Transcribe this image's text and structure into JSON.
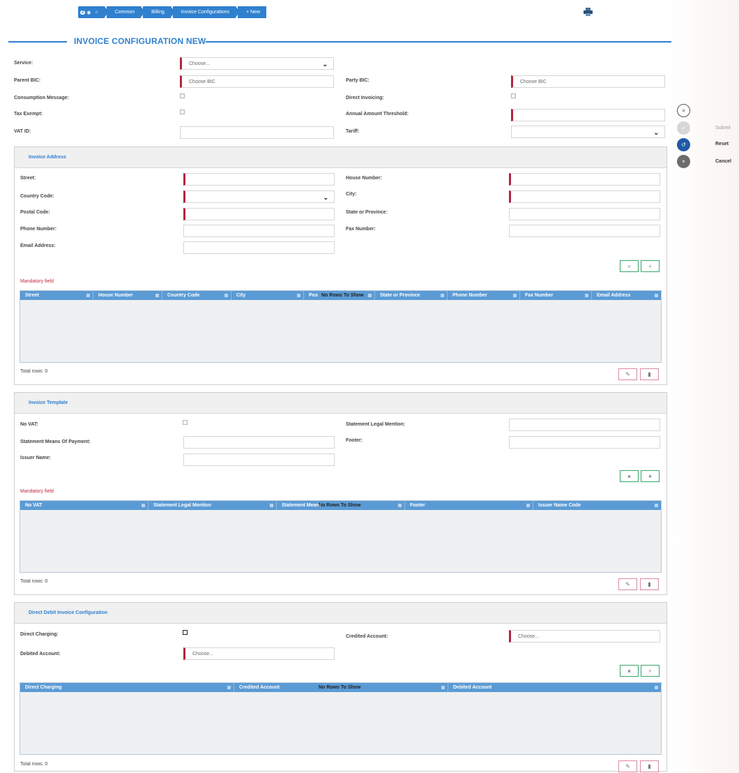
{
  "breadcrumb": {
    "badge": "2",
    "items": [
      "Common",
      "Billing",
      "Invoice Configurations",
      "+ New"
    ]
  },
  "page_title": "INVOICE CONFIGURATION NEW",
  "main": {
    "service_label": "Service:",
    "service_value": "Choose...",
    "parent_bic_label": "Parent BIC:",
    "parent_bic_placeholder": "Choose BIC",
    "party_bic_label": "Party BIC:",
    "party_bic_placeholder": "Choose BIC",
    "consumption_label": "Consumption Message:",
    "direct_invoicing_label": "Direct Invoicing:",
    "tax_exempt_label": "Tax Exempt:",
    "annual_label": "Annual Amount Threshold:",
    "vat_label": "VAT ID:",
    "tariff_label": "Tariff:"
  },
  "actions": {
    "submit": "Submit",
    "reset": "Reset",
    "cancel": "Cancel"
  },
  "address": {
    "title": "Invoice Address",
    "street": "Street:",
    "house_number": "House Number:",
    "country_code": "Country Code:",
    "city": "City:",
    "postal_code": "Postal Code:",
    "state": "State or Province:",
    "phone": "Phone Number:",
    "fax": "Fax Number:",
    "email": "Email Address:",
    "mandatory": "Mandatory field",
    "columns": [
      "Street",
      "House Number",
      "Country Code",
      "City",
      "Pos",
      "State or Province",
      "Phone Number",
      "Fax Number",
      "Email Address"
    ],
    "no_rows": "No Rows To Show",
    "total": "Total rows: 0"
  },
  "template": {
    "title": "Invoice Template",
    "no_vat": "No VAT:",
    "legal_mention": "Statement Legal Mention:",
    "means_payment": "Statement Means Of Payment:",
    "footer": "Footer:",
    "issuer": "Issuer Name:",
    "mandatory": "Mandatory field",
    "columns": [
      "No VAT",
      "Statement Legal Mention",
      "Statement Means",
      "Footer",
      "Issuer Name Code"
    ],
    "no_rows": "No Rows To Show",
    "total": "Total rows: 0"
  },
  "debit": {
    "title": "Direct Debit Invoice Configuration",
    "direct_charging": "Direct Charging:",
    "credited": "Credited Account:",
    "credited_value": "Choose...",
    "debited": "Debited Account:",
    "debited_value": "Choose...",
    "columns": [
      "Direct Charging",
      "Credited Account",
      "Debited Account"
    ],
    "no_rows": "No Rows To Show",
    "total": "Total rows: 0"
  }
}
